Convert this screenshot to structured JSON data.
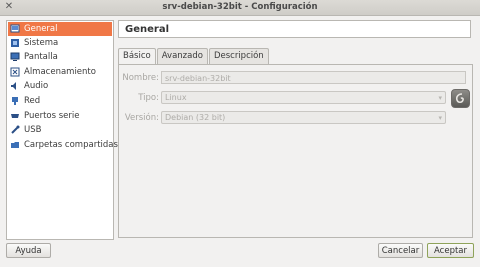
{
  "window": {
    "title": "srv-debian-32bit - Configuración",
    "close_glyph": "✕"
  },
  "sidebar": {
    "items": [
      {
        "label": "General",
        "icon": "general-icon",
        "selected": true
      },
      {
        "label": "Sistema",
        "icon": "system-icon"
      },
      {
        "label": "Pantalla",
        "icon": "display-icon"
      },
      {
        "label": "Almacenamiento",
        "icon": "storage-icon"
      },
      {
        "label": "Audio",
        "icon": "audio-icon"
      },
      {
        "label": "Red",
        "icon": "network-icon"
      },
      {
        "label": "Puertos serie",
        "icon": "serial-ports-icon"
      },
      {
        "label": "USB",
        "icon": "usb-icon"
      },
      {
        "label": "Carpetas compartidas",
        "icon": "shared-folders-icon"
      }
    ]
  },
  "main": {
    "header": "General",
    "tabs": [
      {
        "label": "Básico",
        "active": true
      },
      {
        "label": "Avanzado"
      },
      {
        "label": "Descripción"
      }
    ],
    "form": {
      "name_label": "Nombre:",
      "name_value": "srv-debian-32bit",
      "type_label": "Tipo:",
      "type_value": "Linux",
      "version_label": "Versión:",
      "version_value": "Debian (32 bit)"
    }
  },
  "buttons": {
    "help": "Ayuda",
    "cancel": "Cancelar",
    "accept": "Aceptar"
  },
  "colors": {
    "selection": "#f07746",
    "accept_border": "#8fa35a"
  }
}
